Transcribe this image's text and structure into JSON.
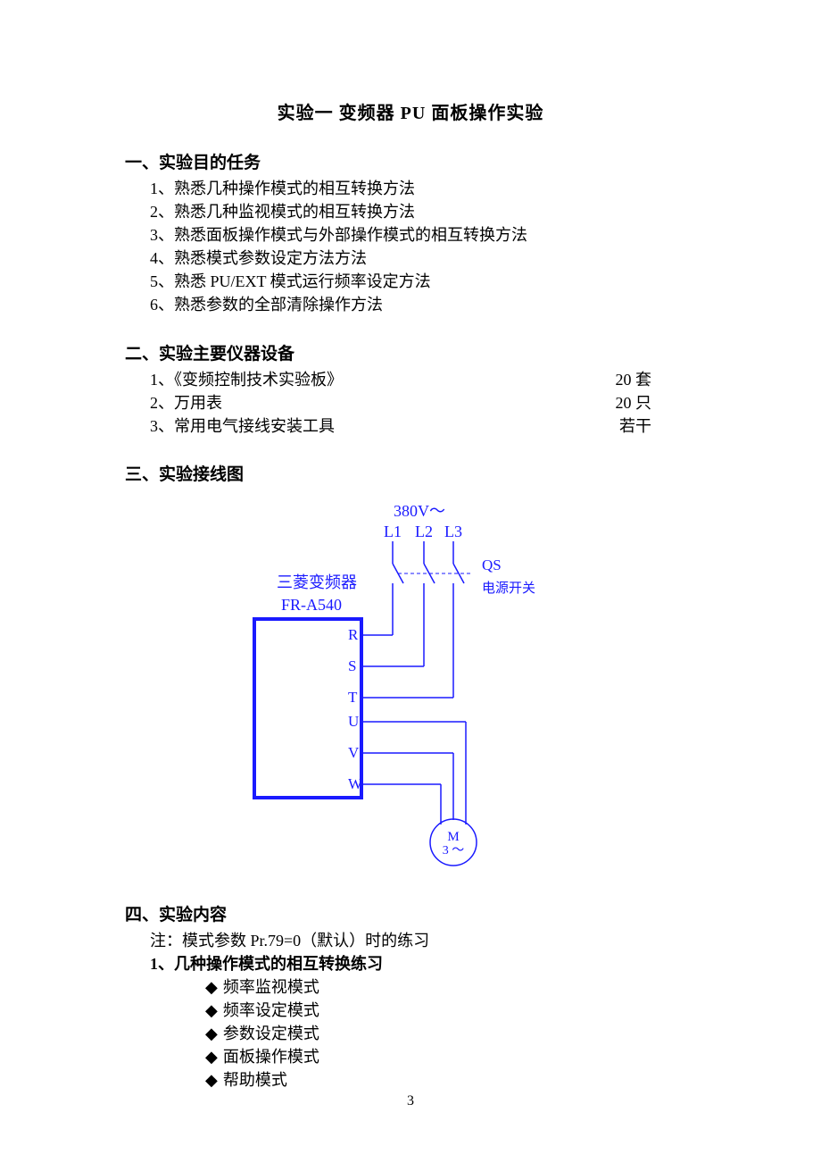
{
  "title": "实验一  变频器 PU 面板操作实验",
  "section1": {
    "head": "一、实验目的任务",
    "items": [
      "1、熟悉几种操作模式的相互转换方法",
      "2、熟悉几种监视模式的相互转换方法",
      "3、熟悉面板操作模式与外部操作模式的相互转换方法",
      "4、熟悉模式参数设定方法方法",
      "5、熟悉 PU/EXT 模式运行频率设定方法",
      "6、熟悉参数的全部清除操作方法"
    ]
  },
  "section2": {
    "head": "二、实验主要仪器设备",
    "items": [
      {
        "label": "1、《变频控制技术实验板》",
        "qty": "20 套"
      },
      {
        "label": "2、万用表",
        "qty": "20 只"
      },
      {
        "label": "3、常用电气接线安装工具",
        "qty": "若干"
      }
    ]
  },
  "section3": {
    "head": "三、实验接线图"
  },
  "diagram": {
    "supply_voltage": "380V～",
    "phase_labels": [
      "L1",
      "L2",
      "L3"
    ],
    "switch_label": "QS",
    "switch_name": "电源开关",
    "device_line1": "三菱变频器",
    "device_line2": "FR-A540",
    "terminals": [
      "R",
      "S",
      "T",
      "U",
      "V",
      "W"
    ],
    "motor_line1": "M",
    "motor_line2": "3 ～"
  },
  "section4": {
    "head": "四、实验内容",
    "note": "注：模式参数 Pr.79=0（默认）时的练习",
    "sub_head": "1、几种操作模式的相互转换练习",
    "bullets": [
      "频率监视模式",
      "频率设定模式",
      "参数设定模式",
      "面板操作模式",
      "帮助模式"
    ]
  },
  "page_number": "3"
}
